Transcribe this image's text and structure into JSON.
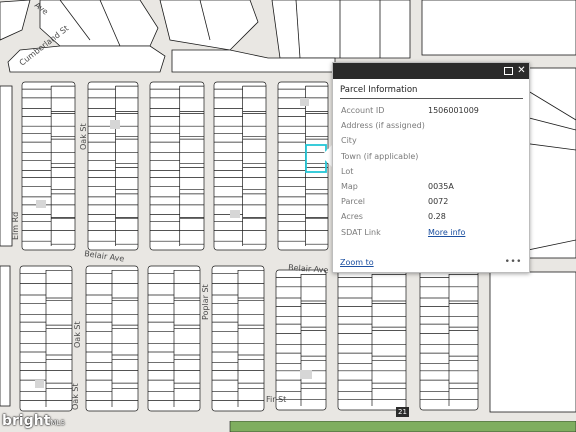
{
  "map": {
    "streets": {
      "cumberland": "Cumberland St",
      "ave_top": "Ave",
      "oak_upper": "Oak St",
      "oak_mid": "Oak St",
      "oak_lower": "Oak St",
      "elm": "Elm Rd",
      "belair": "Belair Ave",
      "belair_right": "Belair Ave",
      "poplar": "Poplar St",
      "fir": "Fir St"
    },
    "route_shield": "21",
    "colors": {
      "parcel_fill": "#ffffff",
      "parcel_line": "#1a1a1a",
      "street": "#e9e7e3",
      "park": "#7fae5f",
      "highlight": "#25c6d6"
    }
  },
  "popup": {
    "title": "Parcel Information",
    "fields": [
      {
        "label": "Account ID",
        "value": "1506001009"
      },
      {
        "label": "Address (if assigned)",
        "value": ""
      },
      {
        "label": "City",
        "value": ""
      },
      {
        "label": "Town (if applicable)",
        "value": ""
      },
      {
        "label": "Lot",
        "value": ""
      },
      {
        "label": "Map",
        "value": "0035A"
      },
      {
        "label": "Parcel",
        "value": "0072"
      },
      {
        "label": "Acres",
        "value": "0.28"
      }
    ],
    "sdat_label": "SDAT Link",
    "sdat_link": "More info",
    "zoom_to": "Zoom to",
    "more": "•••"
  },
  "watermark": {
    "brand": "bright",
    "suffix": "MLS"
  }
}
